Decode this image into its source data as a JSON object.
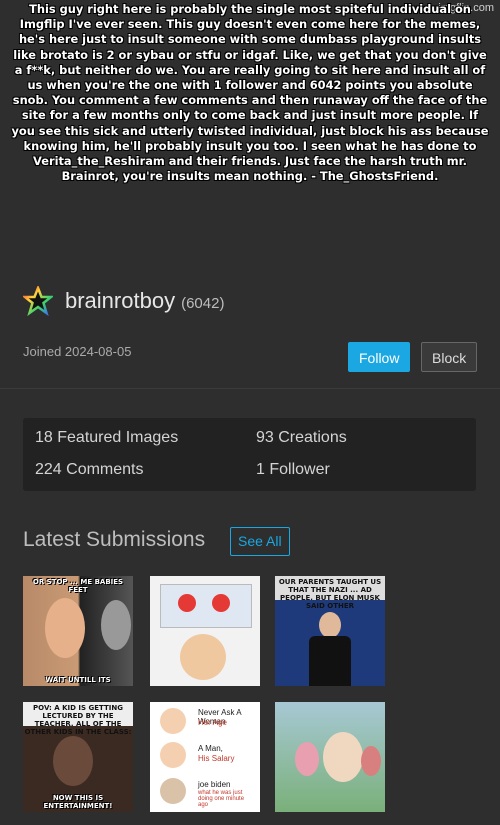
{
  "watermark": "imgflip.com",
  "caption": "This guy right here is probably the single most spiteful individual on Imgflip I've ever seen. This guy doesn't even come here for the memes, he's here just to insult someone with some dumbass playground insults like brotato is 2 or sybau or stfu or idgaf. Like, we get that you don't give a f**k, but neither do we. You are really going to sit here and insult all of us when you're the one with 1 follower and 6042 points you absolute snob. You comment a few comments and then runaway off the face of the site for a few months only to come back and just insult more people. If you see this sick and utterly twisted individual, just block his ass because knowing him, he'll probably insult you too. I seen what he has done to Verita_the_Reshiram and their friends. Just face the harsh truth mr. Brainrot, you're insults mean nothing. - The_GhostsFriend.",
  "profile": {
    "username": "brainrotboy",
    "points": "(6042)",
    "joined": "Joined 2024-08-05",
    "avatar_icon": "rainbow-star-icon"
  },
  "buttons": {
    "follow": "Follow",
    "block": "Block"
  },
  "colors": {
    "accent": "#1aa7e2",
    "background": "#2e2e2e",
    "panel": "#222222"
  },
  "stats": {
    "featured": "18 Featured Images",
    "creations": "93 Creations",
    "comments": "224 Comments",
    "followers": "1 Follower"
  },
  "submissions": {
    "title": "Latest Submissions",
    "see_all": "See All",
    "thumbs": [
      {
        "top": "OR STOP ... ME BABIES FEET",
        "bottom": "WAIT UNTILL ITS"
      },
      {
        "top": "",
        "bottom": ""
      },
      {
        "top": "OUR PARENTS TAUGHT US THAT THE NAZI ... AD PEOPLE. BUT ELON MUSK SAID OTHER",
        "bottom": ""
      },
      {
        "top": "POV: A KID IS GETTING LECTURED BY THE TEACHER. ALL OF THE OTHER KIDS IN THE CLASS:",
        "bottom": "NOW THIS IS ENTERTAINMENT!"
      },
      {
        "top": "",
        "bottom": "",
        "rows": [
          {
            "main": "Never Ask A Woman",
            "sub": "Her Age"
          },
          {
            "main": "A Man,",
            "sub": "His Salary"
          },
          {
            "main": "joe biden",
            "sub": "what he was just doing one minute ago"
          }
        ]
      },
      {
        "top": "",
        "bottom": ""
      }
    ]
  }
}
